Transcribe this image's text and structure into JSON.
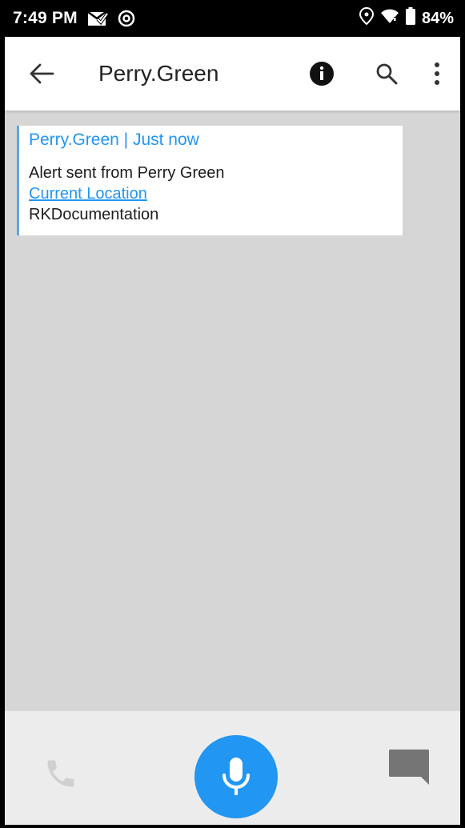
{
  "status_bar": {
    "time": "7:49 PM",
    "left_icons": [
      "mail-check-icon",
      "at-sign-icon"
    ],
    "right_icons": [
      "location-icon",
      "wifi-icon",
      "battery-icon"
    ],
    "battery_percent": "84%"
  },
  "app_bar": {
    "title": "Perry.Green",
    "icons": [
      "back-arrow-icon",
      "info-icon",
      "search-icon",
      "more-vert-icon"
    ]
  },
  "message": {
    "header": "Perry.Green | Just now",
    "lines": [
      "Alert sent from Perry Green",
      "Current Location",
      "RKDocumentation"
    ],
    "link_text": "Current Location"
  },
  "bottom_bar": {
    "icons": [
      "phone-icon",
      "microphone-icon",
      "chat-icon"
    ]
  },
  "colors": {
    "accent": "#2196f3",
    "background": "#d6d6d6",
    "card": "#ffffff",
    "bottom_bar": "#ececec",
    "disabled_icon": "#d0d0d0",
    "chat_icon": "#757575"
  }
}
